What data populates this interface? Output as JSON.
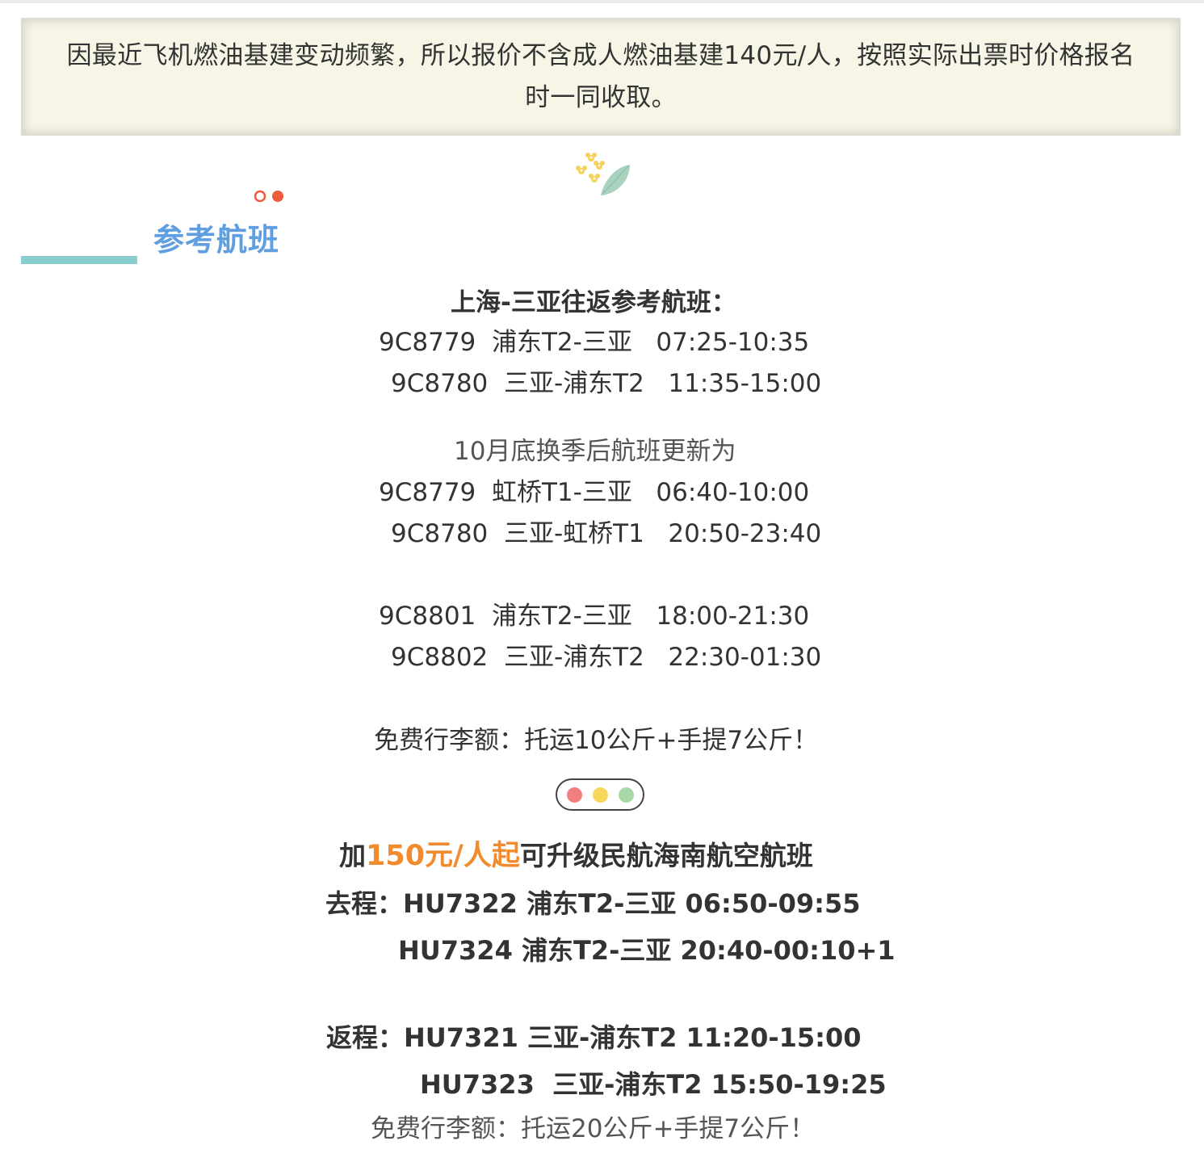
{
  "notice": {
    "line1": "因最近飞机燃油基建变动频繁，所以报价不含成人燃油基建140元/人，按照实际出票时价格报名",
    "line2": "时一同收取。"
  },
  "section": {
    "title": "参考航班"
  },
  "schedule": {
    "heading": "上海-三亚往返参考航班：",
    "original": [
      "9C8779  浦东T2-三亚   07:25-10:35",
      "9C8780  三亚-浦东T2   11:35-15:00"
    ],
    "update_note": "10月底换季后航班更新为",
    "updated": [
      "9C8779  虹桥T1-三亚   06:40-10:00",
      "9C8780  三亚-虹桥T1   20:50-23:40"
    ],
    "extra": [
      "9C8801  浦东T2-三亚   18:00-21:30",
      "9C8802  三亚-浦东T2   22:30-01:30"
    ],
    "baggage": "免费行李额：托运10公斤+手提7公斤！"
  },
  "upgrade": {
    "prefix": "加",
    "price": "150元/人起",
    "suffix": "可升级民航海南航空航班",
    "outbound_label": "去程：",
    "outbound": [
      "HU7322 浦东T2-三亚 06:50-09:55",
      "HU7324 浦东T2-三亚 20:40-00:10+1"
    ],
    "return_label": "返程：",
    "return": [
      "HU7321 三亚-浦东T2 11:20-15:00",
      "HU7323  三亚-浦东T2 15:50-19:25"
    ],
    "baggage": "免费行李额：托运20公斤+手提7公斤！"
  },
  "colors": {
    "title_blue": "#5f9fe0",
    "underline_teal": "#88cccc",
    "price_orange": "#f28a2e",
    "dot_red": "#f08080",
    "dot_yellow": "#f7d75a",
    "dot_green": "#a8d8a8",
    "notice_bg": "#f7f6e6"
  },
  "icons": {
    "decoration": "flower-leaf-icon",
    "dots_top": "two-dots-icon",
    "traffic_dots": "three-dots-divider-icon"
  }
}
